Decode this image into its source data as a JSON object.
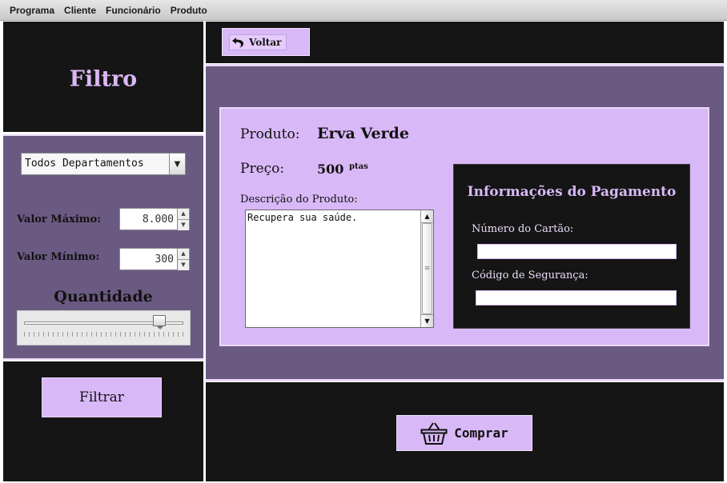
{
  "menubar": {
    "items": [
      "Programa",
      "Cliente",
      "Funcionário",
      "Produto"
    ]
  },
  "filter_panel": {
    "title": "Filtro",
    "department_select": {
      "selected": "Todos Departamentos"
    },
    "max_value": {
      "label": "Valor Máximo:",
      "value": "8.000"
    },
    "min_value": {
      "label": "Valor Mínimo:",
      "value": "300"
    },
    "quantity": {
      "label": "Quantidade",
      "level": 0.88
    },
    "filter_button": "Filtrar"
  },
  "header": {
    "back_button": "Voltar"
  },
  "product": {
    "name_label": "Produto:",
    "name": "Erva Verde",
    "price_label": "Preço:",
    "price": "500",
    "price_unit": "ptas",
    "description_label": "Descrição do Produto:",
    "description": "Recupera sua saúde."
  },
  "payment": {
    "title": "Informações do Pagamento",
    "card_number_label": "Número do Cartão:",
    "card_number_value": "",
    "security_code_label": "Código de Segurança:",
    "security_code_value": ""
  },
  "footer": {
    "buy_button": "Comprar"
  },
  "colors": {
    "accent": "#d9b8f7",
    "dark": "#151515",
    "panel": "#6a5a82"
  }
}
